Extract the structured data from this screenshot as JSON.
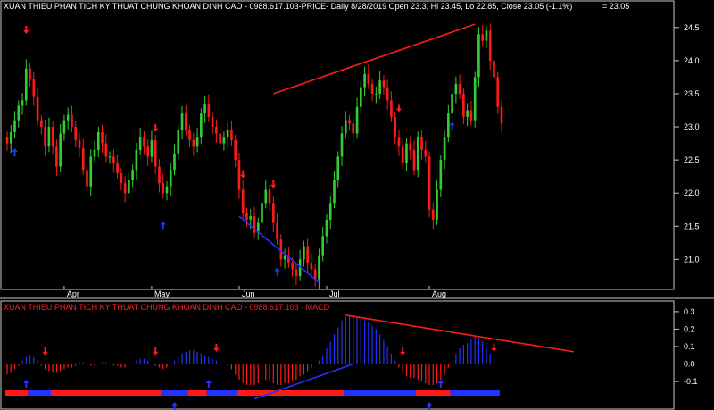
{
  "header": {
    "price_title": "XUAN THIEU PHAN TICH KY THUAT CHUNG KHOAN DINH CAO - 0988.617.103-PRICE- Daily 8/28/2019 Open 23.3, Hi 23.45, Lo 22.85, Close 23.05 (-1.1%)",
    "price_last": "= 23.05",
    "macd_title": "XUAN THIEU PHAN TICH KY THUAT CHUNG KHOAN DINH CAO - 0988.617.103 - MACD"
  },
  "colors": {
    "background": "#000000",
    "up": "#33cc33",
    "down": "#ff1a1a",
    "trend_red": "#ff1a1a",
    "trend_blue": "#2233ff",
    "macd_pos": "#2233ff",
    "macd_neg": "#ff1a1a",
    "grid": "#c8c8c8"
  },
  "chart_data": [
    {
      "type": "candlestick",
      "months": [
        "Apr",
        "May",
        "Jun",
        "Jul",
        "Aug"
      ],
      "month_start_index": [
        15,
        38,
        61,
        84,
        111
      ],
      "ylim": [
        20.6,
        24.7
      ],
      "y_ticks": [
        21.0,
        21.5,
        22.0,
        22.5,
        23.0,
        23.5,
        24.0,
        24.5
      ],
      "last_close": 23.05,
      "closes": [
        22.75,
        22.92,
        23.1,
        23.32,
        23.4,
        23.88,
        23.72,
        23.45,
        23.1,
        23.0,
        22.7,
        23.0,
        22.7,
        22.4,
        22.9,
        23.1,
        23.18,
        23.0,
        22.8,
        22.68,
        22.35,
        22.1,
        22.55,
        22.65,
        22.92,
        22.75,
        22.55,
        22.55,
        22.45,
        22.3,
        22.15,
        22.0,
        22.2,
        22.35,
        22.65,
        22.85,
        22.7,
        22.55,
        22.8,
        22.4,
        22.15,
        22.0,
        22.1,
        22.35,
        22.6,
        22.95,
        23.2,
        22.95,
        22.8,
        22.7,
        22.85,
        23.2,
        23.35,
        23.15,
        23.0,
        22.9,
        22.75,
        22.85,
        22.95,
        22.8,
        22.5,
        22.05,
        21.7,
        21.6,
        21.65,
        21.4,
        21.55,
        21.85,
        22.05,
        21.85,
        21.55,
        21.3,
        21.0,
        21.05,
        20.95,
        20.85,
        20.75,
        21.0,
        21.2,
        20.95,
        20.85,
        20.7,
        21.05,
        21.35,
        21.6,
        21.85,
        22.2,
        22.55,
        22.9,
        23.1,
        23.05,
        22.9,
        23.3,
        23.6,
        23.8,
        23.65,
        23.5,
        23.5,
        23.7,
        23.6,
        23.4,
        23.15,
        22.85,
        22.7,
        22.45,
        22.75,
        22.65,
        22.35,
        22.85,
        22.65,
        22.55,
        21.75,
        21.6,
        22.05,
        22.5,
        22.85,
        23.2,
        23.5,
        23.65,
        23.5,
        23.15,
        23.25,
        23.1,
        23.75,
        24.4,
        24.3,
        24.45,
        24.0,
        23.75,
        23.3,
        23.05
      ],
      "annotations": {
        "sell_arrow_index": [
          5,
          39,
          62,
          70,
          103
        ],
        "buy_arrow_index": [
          2,
          41,
          71,
          117
        ]
      },
      "trendlines": [
        {
          "color": "trend_red",
          "from": [
            70,
            23.5
          ],
          "to": [
            123,
            24.55
          ]
        },
        {
          "color": "trend_blue",
          "from": [
            61,
            21.65
          ],
          "to": [
            82,
            20.65
          ]
        }
      ]
    },
    {
      "type": "histogram",
      "name": "MACD",
      "ylim": [
        -0.12,
        0.32
      ],
      "y_ticks": [
        0.3,
        0.2,
        0.1,
        0.0,
        -0.1
      ],
      "values": [
        -0.06,
        -0.05,
        -0.03,
        -0.01,
        0.02,
        0.04,
        0.05,
        0.04,
        0.02,
        -0.01,
        -0.03,
        -0.04,
        -0.05,
        -0.05,
        -0.04,
        -0.03,
        -0.02,
        -0.02,
        -0.01,
        0.01,
        0.01,
        0.0,
        -0.01,
        -0.01,
        0.0,
        0.01,
        0.01,
        0.0,
        -0.01,
        -0.01,
        -0.02,
        -0.02,
        -0.01,
        0.0,
        0.02,
        0.03,
        0.03,
        0.02,
        0.0,
        -0.01,
        -0.02,
        -0.03,
        -0.02,
        0.0,
        0.02,
        0.04,
        0.06,
        0.07,
        0.08,
        0.08,
        0.07,
        0.06,
        0.05,
        0.04,
        0.03,
        0.02,
        0.01,
        0.0,
        -0.01,
        -0.03,
        -0.06,
        -0.09,
        -0.11,
        -0.12,
        -0.12,
        -0.12,
        -0.11,
        -0.1,
        -0.09,
        -0.1,
        -0.11,
        -0.12,
        -0.12,
        -0.11,
        -0.11,
        -0.1,
        -0.09,
        -0.07,
        -0.06,
        -0.04,
        -0.02,
        0.0,
        0.02,
        0.05,
        0.09,
        0.13,
        0.17,
        0.21,
        0.25,
        0.27,
        0.28,
        0.28,
        0.27,
        0.26,
        0.25,
        0.24,
        0.22,
        0.2,
        0.17,
        0.14,
        0.1,
        0.06,
        0.02,
        -0.02,
        -0.05,
        -0.07,
        -0.08,
        -0.08,
        -0.09,
        -0.1,
        -0.11,
        -0.12,
        -0.12,
        -0.11,
        -0.09,
        -0.06,
        -0.02,
        0.02,
        0.06,
        0.09,
        0.11,
        0.12,
        0.14,
        0.16,
        0.15,
        0.13,
        0.1,
        0.06,
        0.02
      ],
      "signal_band": [
        {
          "from": 0,
          "to": 5,
          "color": "down"
        },
        {
          "from": 6,
          "to": 11,
          "color": "pos"
        },
        {
          "from": 12,
          "to": 40,
          "color": "down"
        },
        {
          "from": 41,
          "to": 47,
          "color": "pos"
        },
        {
          "from": 48,
          "to": 52,
          "color": "down"
        },
        {
          "from": 53,
          "to": 60,
          "color": "pos"
        },
        {
          "from": 61,
          "to": 88,
          "color": "down"
        },
        {
          "from": 89,
          "to": 107,
          "color": "pos"
        },
        {
          "from": 108,
          "to": 116,
          "color": "down"
        },
        {
          "from": 117,
          "to": 129,
          "color": "pos"
        }
      ],
      "annotations": {
        "sell_arrow_index": [
          10,
          39,
          55,
          104,
          128
        ],
        "buy_arrow_index": [
          5,
          44,
          53,
          111,
          114
        ]
      },
      "trendlines": [
        {
          "color": "trend_red",
          "from": [
            89,
            0.28
          ],
          "to": [
            149,
            0.07
          ]
        },
        {
          "color": "trend_blue",
          "from": [
            65,
            -0.2
          ],
          "to": [
            91,
            0.0
          ]
        }
      ]
    }
  ]
}
